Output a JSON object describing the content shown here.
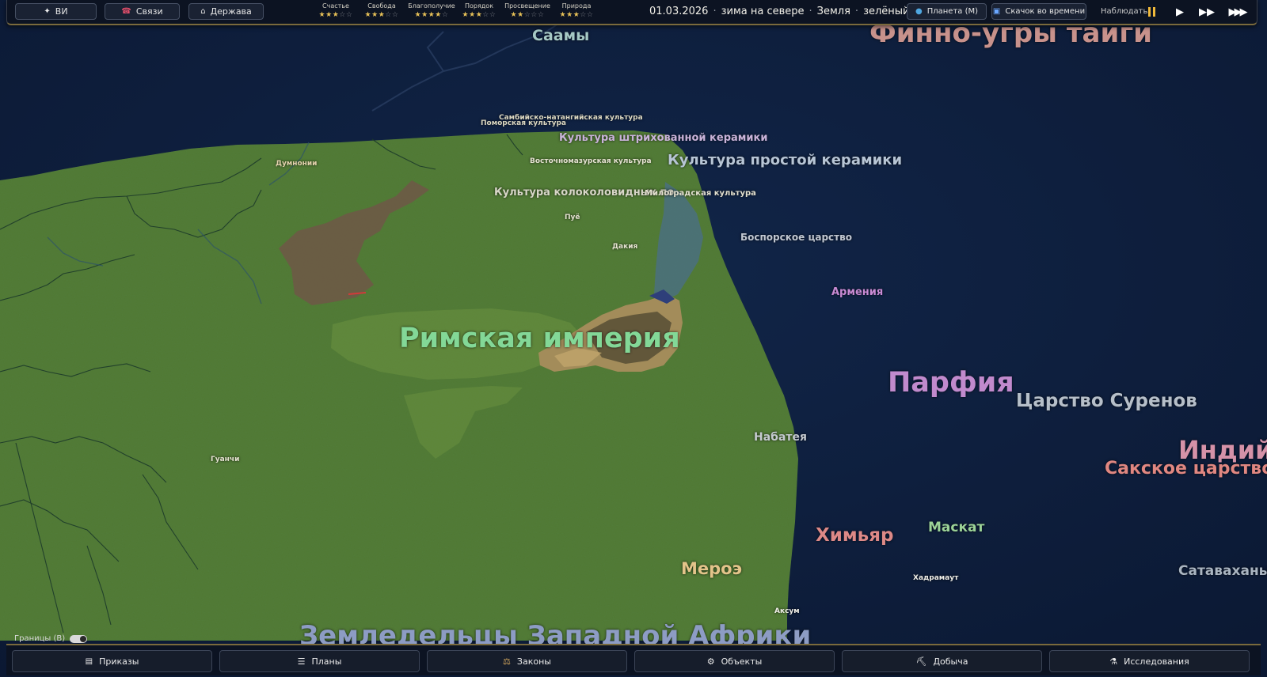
{
  "topbar": {
    "buttons": [
      {
        "id": "ai",
        "label": "ВИ",
        "icon": "sparkle-icon"
      },
      {
        "id": "relations",
        "label": "Связи",
        "icon": "link-icon"
      },
      {
        "id": "state",
        "label": "Держава",
        "icon": "government-building-icon"
      }
    ],
    "stats": [
      {
        "label": "Счастье",
        "stars": 3
      },
      {
        "label": "Свобода",
        "stars": 3
      },
      {
        "label": "Благополучие",
        "stars": 4
      },
      {
        "label": "Порядок",
        "stars": 3
      },
      {
        "label": "Просвещение",
        "stars": 2
      },
      {
        "label": "Природа",
        "stars": 3
      }
    ],
    "stars_max": 5,
    "date": "01.03.2026",
    "season": "зима на севере",
    "planet_name": "Земля",
    "world_state": "зелёный мир",
    "planet_button": "Планета (M)",
    "timejump_button": "Скачок во времени",
    "observe_label": "Наблюдать"
  },
  "map": {
    "labels": {
      "saamy": "Саамы",
      "finno": "Финно-угры тайги",
      "sambi": "Самбийско-натангийская культура",
      "pomor": "Поморская культура",
      "shtrih": "Культура штрихованной керамики",
      "vostochno": "Восточномазурская культура",
      "prostoy": "Культура простой керамики",
      "dumnonii": "Думнонии",
      "kolokol": "Культура колоколовидных по",
      "milograd": "Милоградская культура",
      "pue": "Пуё",
      "bosporskoe": "Боспорское царство",
      "dakiya": "Дакия",
      "armeniya": "Армения",
      "rim": "Римская империя",
      "parfiya": "Парфия",
      "surenov": "Царство Суренов",
      "indiy": "Индий",
      "nabateya": "Набатея",
      "sakskoe": "Сакское царство",
      "guanchi": "Гуанчи",
      "himyar": "Химьяр",
      "maskat": "Маскат",
      "meroe": "Мероэ",
      "hadramaut": "Хадрамаут",
      "satavahany": "Сатаваханы",
      "aksum": "Аксум",
      "zemled": "Земледельцы Западной Африки"
    },
    "colors": {
      "ocean": "#0f1f3c",
      "land": "#4f7a34",
      "rome_label": "#7ed48a",
      "parthia_label": "#c58ad1",
      "himyar_label": "#e58f8b"
    }
  },
  "borders_toggle": {
    "label": "Границы (B)",
    "on": true
  },
  "bottombar": {
    "buttons": [
      {
        "label": "Приказы",
        "icon": "orders-icon"
      },
      {
        "label": "Планы",
        "icon": "list-icon"
      },
      {
        "label": "Законы",
        "icon": "scales-icon"
      },
      {
        "label": "Объекты",
        "icon": "gear-icon"
      },
      {
        "label": "Добыча",
        "icon": "pickaxe-icon"
      },
      {
        "label": "Исследования",
        "icon": "flask-icon"
      }
    ]
  }
}
